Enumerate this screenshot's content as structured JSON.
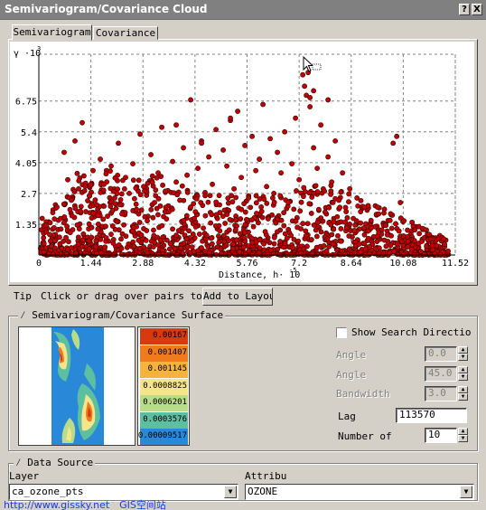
{
  "window": {
    "title": "Semivariogram/Covariance Cloud",
    "help_label": "?",
    "close_label": "X"
  },
  "tabs": [
    {
      "label": "Semivariogram",
      "active": true
    },
    {
      "label": "Covariance",
      "active": false
    }
  ],
  "chart_data": {
    "type": "scatter",
    "ylabel": "γ ·10",
    "ylabel_exponent": "3",
    "xlabel": "Distance, h· 10",
    "xlabel_exponent": "-5",
    "xlim": [
      0,
      11.52
    ],
    "ylim": [
      0,
      8.8
    ],
    "x_ticks": [
      "0",
      "1.44",
      "2.88",
      "4.32",
      "5.76",
      "7.2",
      "8.64",
      "10.08",
      "11.52"
    ],
    "y_ticks": [
      "1.35",
      "2.7",
      "4.05",
      "5.4",
      "6.75"
    ],
    "y_tick_values": [
      1.35,
      2.7,
      4.05,
      5.4,
      6.75
    ],
    "grid": true,
    "point_color": "#c00000",
    "series": [
      {
        "points": [
          [
            0.2,
            1.3
          ],
          [
            0.3,
            0.9
          ],
          [
            0.5,
            2.1
          ],
          [
            0.6,
            1.6
          ],
          [
            0.7,
            4.5
          ],
          [
            0.8,
            3.3
          ],
          [
            0.9,
            2.4
          ],
          [
            1.0,
            5.0
          ],
          [
            1.1,
            2.9
          ],
          [
            1.2,
            5.8
          ],
          [
            1.3,
            1.9
          ],
          [
            1.4,
            2.6
          ],
          [
            1.5,
            3.7
          ],
          [
            1.6,
            2.2
          ],
          [
            1.7,
            4.2
          ],
          [
            1.8,
            3.1
          ],
          [
            1.9,
            1.7
          ],
          [
            2.0,
            3.9
          ],
          [
            2.1,
            2.5
          ],
          [
            2.2,
            4.9
          ],
          [
            2.3,
            1.8
          ],
          [
            2.4,
            3.4
          ],
          [
            2.5,
            2.7
          ],
          [
            2.6,
            4.0
          ],
          [
            2.7,
            2.0
          ],
          [
            2.8,
            5.3
          ],
          [
            2.9,
            3.0
          ],
          [
            3.0,
            1.5
          ],
          [
            3.1,
            4.4
          ],
          [
            3.2,
            2.3
          ],
          [
            3.3,
            3.6
          ],
          [
            3.4,
            5.6
          ],
          [
            3.5,
            2.8
          ],
          [
            3.6,
            1.9
          ],
          [
            3.7,
            4.1
          ],
          [
            3.8,
            3.2
          ],
          [
            3.9,
            2.4
          ],
          [
            4.0,
            4.7
          ],
          [
            4.1,
            3.5
          ],
          [
            4.2,
            2.1
          ],
          [
            4.3,
            1.6
          ],
          [
            4.4,
            3.8
          ],
          [
            4.5,
            5.0
          ],
          [
            4.6,
            2.6
          ],
          [
            4.7,
            4.3
          ],
          [
            4.8,
            3.1
          ],
          [
            4.9,
            5.5
          ],
          [
            5.0,
            2.2
          ],
          [
            5.1,
            4.6
          ],
          [
            5.2,
            3.9
          ],
          [
            5.3,
            5.9
          ],
          [
            5.4,
            2.9
          ],
          [
            5.5,
            6.3
          ],
          [
            5.6,
            3.4
          ],
          [
            5.7,
            4.8
          ],
          [
            5.8,
            2.5
          ],
          [
            5.9,
            5.2
          ],
          [
            6.0,
            3.7
          ],
          [
            6.1,
            4.2
          ],
          [
            6.2,
            6.6
          ],
          [
            6.3,
            3.0
          ],
          [
            6.4,
            5.1
          ],
          [
            6.5,
            2.7
          ],
          [
            6.6,
            4.5
          ],
          [
            6.7,
            3.6
          ],
          [
            6.8,
            5.4
          ],
          [
            6.9,
            2.3
          ],
          [
            7.0,
            4.0
          ],
          [
            7.1,
            6.0
          ],
          [
            7.2,
            3.3
          ],
          [
            7.3,
            7.9
          ],
          [
            7.4,
            7.0
          ],
          [
            7.5,
            6.5
          ],
          [
            7.6,
            4.7
          ],
          [
            7.7,
            3.8
          ],
          [
            7.8,
            5.7
          ],
          [
            7.9,
            2.8
          ],
          [
            8.0,
            4.3
          ],
          [
            8.1,
            3.2
          ],
          [
            8.2,
            5.0
          ],
          [
            8.3,
            2.4
          ],
          [
            8.4,
            3.6
          ],
          [
            8.5,
            1.9
          ],
          [
            8.6,
            2.9
          ],
          [
            8.7,
            1.6
          ],
          [
            8.8,
            2.5
          ],
          [
            8.9,
            1.4
          ],
          [
            9.0,
            2.1
          ],
          [
            9.2,
            1.2
          ],
          [
            9.4,
            1.8
          ],
          [
            9.6,
            1.3
          ],
          [
            9.8,
            4.9
          ],
          [
            10.0,
            2.3
          ],
          [
            10.1,
            1.5
          ],
          [
            10.2,
            0.8
          ],
          [
            10.4,
            1.1
          ],
          [
            10.6,
            0.6
          ],
          [
            10.8,
            0.9
          ],
          [
            11.0,
            0.4
          ],
          [
            11.2,
            0.7
          ],
          [
            7.45,
            8.0
          ],
          [
            7.6,
            7.2
          ],
          [
            7.5,
            6.9
          ],
          [
            7.35,
            7.4
          ],
          [
            8.0,
            6.8
          ],
          [
            3.8,
            5.7
          ],
          [
            4.2,
            6.8
          ],
          [
            4.5,
            4.9
          ],
          [
            5.3,
            6.0
          ],
          [
            9.9,
            5.2
          ]
        ]
      }
    ]
  },
  "tip": {
    "label": "Tip",
    "text": "Click or drag over pairs to",
    "button_label": "Add to Layout"
  },
  "surface": {
    "group_label": "Semivariogram/Covariance Surface",
    "legend": [
      {
        "label": "0.00167",
        "color": "#d83a10"
      },
      {
        "label": "0.001407",
        "color": "#f07a1c"
      },
      {
        "label": "0.001145",
        "color": "#f6b23c"
      },
      {
        "label": "0.0008825",
        "color": "#f4e48a"
      },
      {
        "label": "0.0006201",
        "color": "#b8dc88"
      },
      {
        "label": "0.0003576",
        "color": "#5cc0a0"
      },
      {
        "label": "0.00009517",
        "color": "#2a88d8"
      }
    ],
    "show_search_direction_label": "Show Search Directio",
    "angle1_label": "Angle",
    "angle1_value": "0.0",
    "angle2_label": "Angle",
    "angle2_value": "45.0",
    "bandwidth_label": "Bandwidth",
    "bandwidth_value": "3.0",
    "lag_label": "Lag",
    "lag_value": "113570",
    "number_of_label": "Number of",
    "number_of_value": "10"
  },
  "data_source": {
    "group_label": "Data Source",
    "layer_label": "Layer",
    "layer_value": "ca_ozone_pts",
    "attribute_label": "Attribu",
    "attribute_value": "OZONE"
  },
  "watermark": "http://www.gissky.net　GIS空间站",
  "icons": {
    "collapse": "collapse-icon",
    "cursor": "mouse-cursor-icon",
    "dropdown": "chevron-down-icon",
    "spin_up": "spin-up-icon",
    "spin_down": "spin-down-icon"
  }
}
